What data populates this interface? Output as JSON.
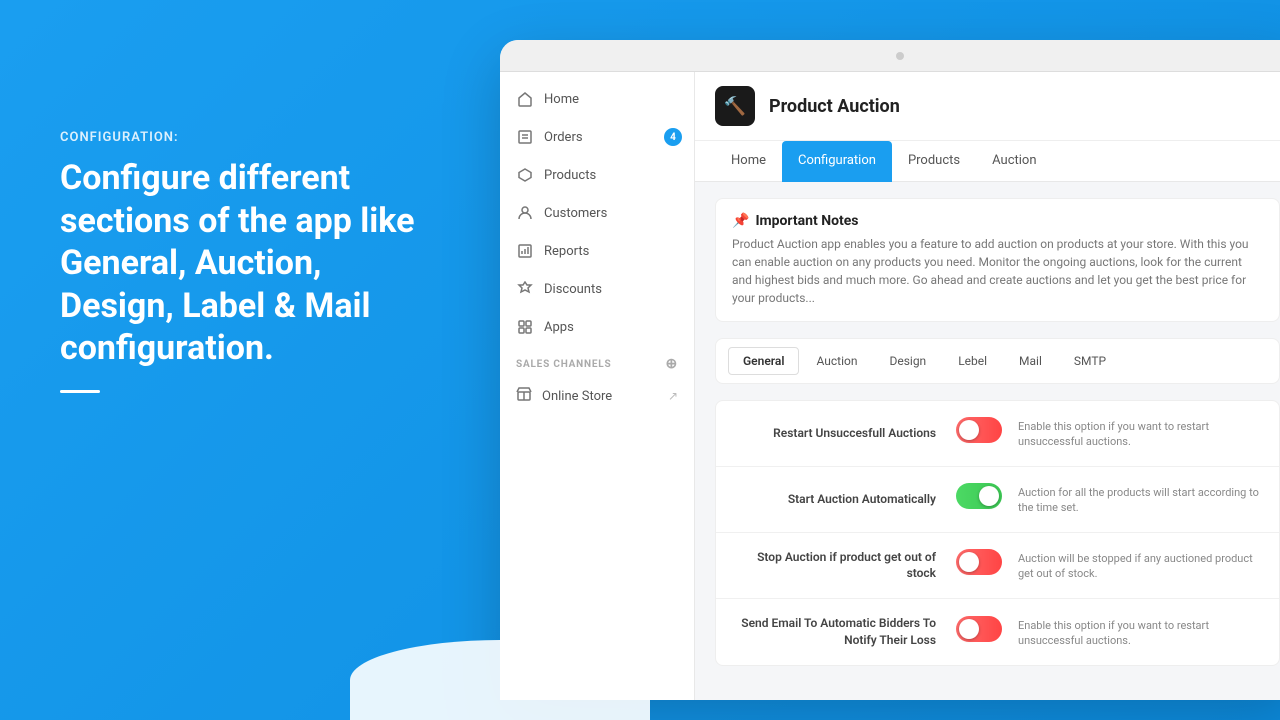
{
  "left": {
    "label": "CONFIGURATION:",
    "title": "Configure different sections of the app like General, Auction, Design, Label & Mail configuration."
  },
  "sidebar": {
    "items": [
      {
        "id": "home",
        "label": "Home",
        "icon": "home-icon",
        "badge": null
      },
      {
        "id": "orders",
        "label": "Orders",
        "icon": "orders-icon",
        "badge": "4"
      },
      {
        "id": "products",
        "label": "Products",
        "icon": "products-icon",
        "badge": null
      },
      {
        "id": "customers",
        "label": "Customers",
        "icon": "customers-icon",
        "badge": null
      },
      {
        "id": "reports",
        "label": "Reports",
        "icon": "reports-icon",
        "badge": null
      },
      {
        "id": "discounts",
        "label": "Discounts",
        "icon": "discounts-icon",
        "badge": null
      },
      {
        "id": "apps",
        "label": "Apps",
        "icon": "apps-icon",
        "badge": null
      }
    ],
    "section_label": "SALES CHANNELS",
    "channels": [
      {
        "id": "online-store",
        "label": "Online Store"
      }
    ]
  },
  "app": {
    "title": "Product Auction",
    "icon": "🔨"
  },
  "nav_tabs": [
    {
      "id": "home",
      "label": "Home",
      "active": false
    },
    {
      "id": "configuration",
      "label": "Configuration",
      "active": true
    },
    {
      "id": "products",
      "label": "Products",
      "active": false
    },
    {
      "id": "auction",
      "label": "Auction",
      "active": false
    }
  ],
  "notes": {
    "title": "Important Notes",
    "icon": "📌",
    "text": "Product Auction app enables you a feature to add auction on products at your store. With this you can enable auction on any products you need. Monitor the ongoing auctions, look for the current and highest bids and much more. Go ahead and create auctions and let you get the best price for your products..."
  },
  "config_tabs": [
    {
      "id": "general",
      "label": "General",
      "active": true
    },
    {
      "id": "auction",
      "label": "Auction",
      "active": false
    },
    {
      "id": "design",
      "label": "Design",
      "active": false
    },
    {
      "id": "lebel",
      "label": "Lebel",
      "active": false
    },
    {
      "id": "mail",
      "label": "Mail",
      "active": false
    },
    {
      "id": "smtp",
      "label": "SMTP",
      "active": false
    }
  ],
  "settings": [
    {
      "id": "restart-unsuccessful",
      "label": "Restart Unsuccesfull Auctions",
      "state": "off",
      "description": "Enable this option if you want to restart unsuccessful auctions."
    },
    {
      "id": "start-automatically",
      "label": "Start Auction Automatically",
      "state": "on",
      "description": "Auction for all the products will start according to the time set."
    },
    {
      "id": "stop-out-of-stock",
      "label": "Stop Auction if product get out of stock",
      "state": "off",
      "description": "Auction will be stopped if any auctioned product get out of stock."
    },
    {
      "id": "send-email",
      "label": "Send Email To Automatic Bidders To Notify Their Loss",
      "state": "off",
      "description": "Enable this option if you want to restart unsuccessful auctions."
    }
  ]
}
